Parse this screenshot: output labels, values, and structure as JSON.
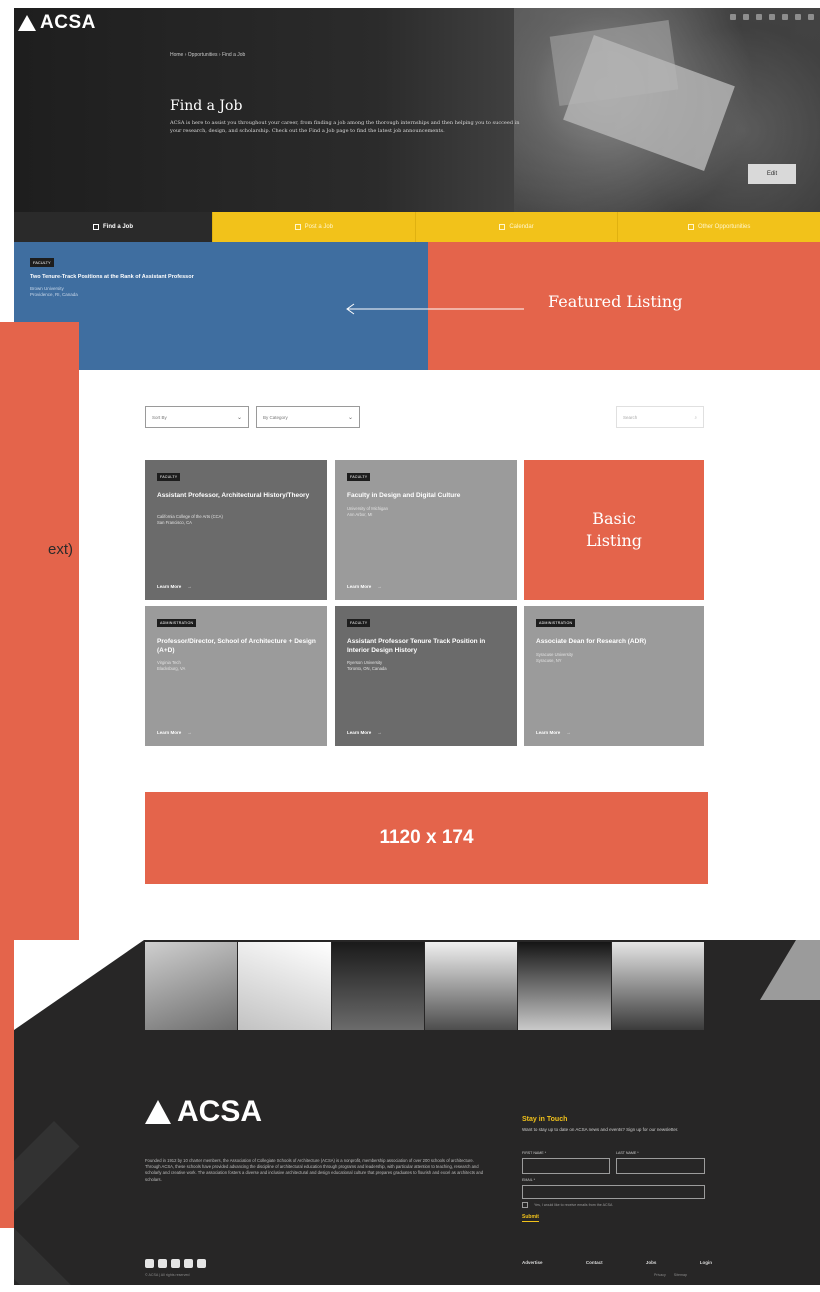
{
  "header": {
    "logo": "ACSA",
    "breadcrumb": "Home  ›  Opportunities  ›  Find a Job",
    "title": "Find a Job",
    "description": "ACSA is here to assist you throughout your career, from finding a job among the thorough internships and then helping you to succeed in your research, design, and scholarship. Check out the Find a Job page to find the latest job announcements.",
    "cta": "Edit"
  },
  "tabs": [
    {
      "label": "Find a Job",
      "active": true
    },
    {
      "label": "Post a Job",
      "active": false
    },
    {
      "label": "Calendar",
      "active": false
    },
    {
      "label": "Other Opportunities",
      "active": false
    }
  ],
  "featured": {
    "badge": "FACULTY",
    "title": "Two Tenure-Track Positions at the Rank of Assistant Professor",
    "org_line1": "Brown University",
    "org_line2": "Providence, RI, Canada",
    "label": "Featured Listing"
  },
  "left_panel": {
    "text": "ext)"
  },
  "filters": {
    "sort": "Sort By",
    "category": "By Category",
    "search_placeholder": "Search"
  },
  "listings": [
    {
      "badge": "FACULTY",
      "title": "Assistant Professor, Architectural History/Theory",
      "org1": "California College of the Arts (CCA)",
      "org2": "San Francisco, CA",
      "link": "Learn More",
      "tone": "dark"
    },
    {
      "badge": "FACULTY",
      "title": "Faculty in Design and Digital Culture",
      "org1": "University of Michigan",
      "org2": "Ann Arbor, MI",
      "link": "Learn More",
      "tone": "light"
    },
    {
      "badge": "ADMINISTRATION",
      "title": "Professor/Director, School of Architecture + Design (A+D)",
      "org1": "Virginia Tech",
      "org2": "Blacksburg, VA",
      "link": "Learn More",
      "tone": "light"
    },
    {
      "badge": "FACULTY",
      "title": "Assistant Professor Tenure Track Position in Interior Design History",
      "org1": "Ryerson University",
      "org2": "Toronto, ON, Canada",
      "link": "Learn More",
      "tone": "dark"
    },
    {
      "badge": "ADMINISTRATION",
      "title": "Associate Dean for Research (ADR)",
      "org1": "Syracuse University",
      "org2": "Syracuse, NY",
      "link": "Learn More",
      "tone": "light"
    }
  ],
  "basic_listing_label": "Basic\nListing",
  "ad": {
    "label": "1120 x 174"
  },
  "footer": {
    "logo": "ACSA",
    "about": "Founded in 1912 by 10 charter members, the Association of Collegiate Schools of Architecture (ACSA) is a nonprofit, membership association of over 200 schools of architecture. Through ACSA, these schools have provided advancing the discipline of architectural education through programs and leadership, with particular attention to teaching, research and scholarly and creative work. The association fosters a diverse and inclusive architectural and design educational culture that prepares graduates to flourish and excel as architects and scholars.",
    "stay_title": "Stay in Touch",
    "stay_desc": "Want to stay up to date on ACSA news and events? Sign up for our newsletter.",
    "first_name": "FIRST NAME *",
    "last_name": "LAST NAME *",
    "email": "EMAIL *",
    "consent": "Yes, I would like to receive emails from the ACSA",
    "submit": "Submit",
    "nav": [
      "Advertise",
      "Contact",
      "Jobs",
      "Login"
    ],
    "copyright": "© ACSA | All rights reserved",
    "legal": [
      "Privacy",
      "Sitemap"
    ]
  }
}
